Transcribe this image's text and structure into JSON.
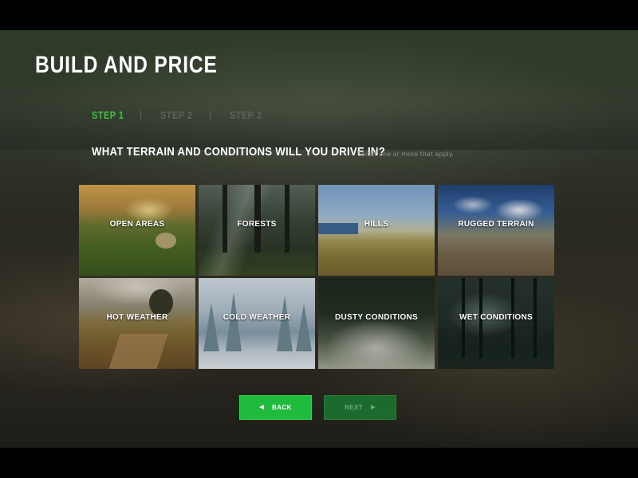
{
  "page": {
    "title": "BUILD AND PRICE",
    "accent_color": "#3cc43c"
  },
  "steps": [
    {
      "label": "STEP 1",
      "state": "active"
    },
    {
      "label": "STEP 2",
      "state": "inactive"
    },
    {
      "label": "STEP 3",
      "state": "inactive"
    }
  ],
  "question": {
    "text": "WHAT TERRAIN AND CONDITIONS WILL YOU DRIVE IN?",
    "hint": "Select one or more that apply."
  },
  "terrain_options": [
    {
      "label": "OPEN AREAS"
    },
    {
      "label": "FORESTS"
    },
    {
      "label": "HILLS"
    },
    {
      "label": "RUGGED TERRAIN"
    },
    {
      "label": "HOT WEATHER"
    },
    {
      "label": "COLD WEATHER"
    },
    {
      "label": "DUSTY CONDITIONS"
    },
    {
      "label": "WET CONDITIONS"
    }
  ],
  "buttons": {
    "back": {
      "label": "BACK",
      "icon": "arrow-left-icon",
      "color": "#1fbb3c"
    },
    "next": {
      "label": "NEXT",
      "icon": "arrow-right-icon",
      "color": "#1d6a2e"
    }
  }
}
